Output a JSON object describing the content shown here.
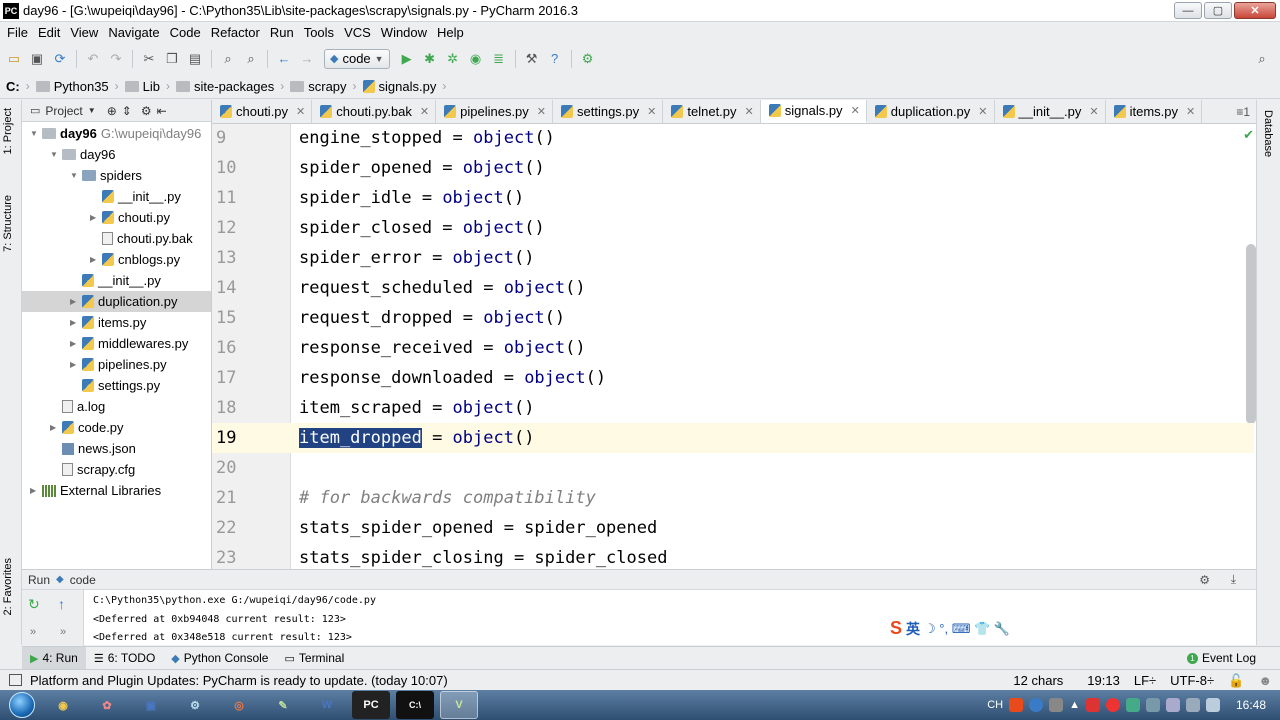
{
  "window": {
    "title": "day96 - [G:\\wupeiqi\\day96] - C:\\Python35\\Lib\\site-packages\\scrapy\\signals.py - PyCharm 2016.3",
    "app_icon": "PC"
  },
  "menu": [
    "File",
    "Edit",
    "View",
    "Navigate",
    "Code",
    "Refactor",
    "Run",
    "Tools",
    "VCS",
    "Window",
    "Help"
  ],
  "toolbar": {
    "run_config": "code"
  },
  "breadcrumb": [
    "C:",
    "Python35",
    "Lib",
    "site-packages",
    "scrapy",
    "signals.py"
  ],
  "side_tabs": {
    "project": "1: Project",
    "structure": "7: Structure",
    "favorites": "2: Favorites",
    "database": "Database"
  },
  "project_panel": {
    "header": "Project",
    "tree": [
      {
        "label": "day96",
        "extra": "G:\\wupeiqi\\day96",
        "indent": 0,
        "icon": "folder",
        "arrow": "down",
        "bold": true
      },
      {
        "label": "day96",
        "indent": 1,
        "icon": "folder",
        "arrow": "down"
      },
      {
        "label": "spiders",
        "indent": 2,
        "icon": "pkg",
        "arrow": "down"
      },
      {
        "label": "__init__.py",
        "indent": 3,
        "icon": "py",
        "arrow": ""
      },
      {
        "label": "chouti.py",
        "indent": 3,
        "icon": "py",
        "arrow": "right"
      },
      {
        "label": "chouti.py.bak",
        "indent": 3,
        "icon": "file",
        "arrow": ""
      },
      {
        "label": "cnblogs.py",
        "indent": 3,
        "icon": "py",
        "arrow": "right"
      },
      {
        "label": "__init__.py",
        "indent": 2,
        "icon": "py",
        "arrow": ""
      },
      {
        "label": "duplication.py",
        "indent": 2,
        "icon": "py",
        "arrow": "right",
        "selected": true
      },
      {
        "label": "items.py",
        "indent": 2,
        "icon": "py",
        "arrow": "right"
      },
      {
        "label": "middlewares.py",
        "indent": 2,
        "icon": "py",
        "arrow": "right"
      },
      {
        "label": "pipelines.py",
        "indent": 2,
        "icon": "py",
        "arrow": "right"
      },
      {
        "label": "settings.py",
        "indent": 2,
        "icon": "py",
        "arrow": ""
      },
      {
        "label": "a.log",
        "indent": 1,
        "icon": "file",
        "arrow": ""
      },
      {
        "label": "code.py",
        "indent": 1,
        "icon": "py",
        "arrow": "right"
      },
      {
        "label": "news.json",
        "indent": 1,
        "icon": "json",
        "arrow": ""
      },
      {
        "label": "scrapy.cfg",
        "indent": 1,
        "icon": "file",
        "arrow": ""
      },
      {
        "label": "External Libraries",
        "indent": 0,
        "icon": "lib",
        "arrow": "right"
      }
    ]
  },
  "tabs": [
    {
      "label": "chouti.py",
      "active": false
    },
    {
      "label": "chouti.py.bak",
      "active": false
    },
    {
      "label": "pipelines.py",
      "active": false
    },
    {
      "label": "settings.py",
      "active": false
    },
    {
      "label": "telnet.py",
      "active": false
    },
    {
      "label": "signals.py",
      "active": true
    },
    {
      "label": "duplication.py",
      "active": false
    },
    {
      "label": "__init__.py",
      "active": false
    },
    {
      "label": "items.py",
      "active": false
    }
  ],
  "tab_overflow": "≡1",
  "editor": {
    "lines": [
      {
        "num": "9",
        "name": "engine_stopped",
        "rest": " = ",
        "kw": "object",
        "tail": "()"
      },
      {
        "num": "10",
        "name": "spider_opened",
        "rest": " = ",
        "kw": "object",
        "tail": "()"
      },
      {
        "num": "11",
        "name": "spider_idle",
        "rest": " = ",
        "kw": "object",
        "tail": "()"
      },
      {
        "num": "12",
        "name": "spider_closed",
        "rest": " = ",
        "kw": "object",
        "tail": "()"
      },
      {
        "num": "13",
        "name": "spider_error",
        "rest": " = ",
        "kw": "object",
        "tail": "()"
      },
      {
        "num": "14",
        "name": "request_scheduled",
        "rest": " = ",
        "kw": "object",
        "tail": "()"
      },
      {
        "num": "15",
        "name": "request_dropped",
        "rest": " = ",
        "kw": "object",
        "tail": "()"
      },
      {
        "num": "16",
        "name": "response_received",
        "rest": " = ",
        "kw": "object",
        "tail": "()"
      },
      {
        "num": "17",
        "name": "response_downloaded",
        "rest": " = ",
        "kw": "object",
        "tail": "()"
      },
      {
        "num": "18",
        "name": "item_scraped",
        "rest": " = ",
        "kw": "object",
        "tail": "()"
      },
      {
        "num": "19",
        "name": "item_dropped",
        "rest": " = ",
        "kw": "object",
        "tail": "()",
        "current": true,
        "selected_name": true
      },
      {
        "num": "20",
        "name": "",
        "rest": "",
        "kw": "",
        "tail": ""
      },
      {
        "num": "21",
        "comment": "# for backwards compatibility"
      },
      {
        "num": "22",
        "name": "stats_spider_opened",
        "rest": " = spider_opened",
        "kw": "",
        "tail": ""
      },
      {
        "num": "23",
        "name": "stats_spider_closing",
        "rest": " = spider_closed",
        "kw": "",
        "tail": ""
      }
    ]
  },
  "run_panel": {
    "label": "Run",
    "config": "code",
    "console": [
      "C:\\Python35\\python.exe G:/wupeiqi/day96/code.py",
      "<Deferred at 0xb94048 current result: 123>",
      "<Deferred at 0x348e518 current result: 123>"
    ],
    "ime": {
      "brand": "S",
      "text": "英",
      "symbols": "☽ °, ⌨ 👕 🔧"
    }
  },
  "bottom_tabs": [
    {
      "label": "4: Run",
      "icon": "run-icon",
      "active": true
    },
    {
      "label": "6: TODO",
      "icon": "todo-icon",
      "active": false
    },
    {
      "label": "Python Console",
      "icon": "python-console-icon",
      "active": false
    },
    {
      "label": "Terminal",
      "icon": "terminal-icon",
      "active": false
    }
  ],
  "event_log": {
    "label": "Event Log",
    "count": "1"
  },
  "status": {
    "message": "Platform and Plugin Updates: PyCharm is ready to update. (today 10:07)",
    "chars": "12 chars",
    "position": "19:13",
    "line_sep": "LF÷",
    "encoding": "UTF-8÷"
  },
  "taskbar": {
    "apps": [
      "chrome",
      "explorer",
      "save",
      "pycharm-tools",
      "chrome-browser",
      "notepad",
      "word",
      "pycharm",
      "cmd",
      "vue"
    ],
    "tray_lang": "CH",
    "clock": "16:48"
  }
}
